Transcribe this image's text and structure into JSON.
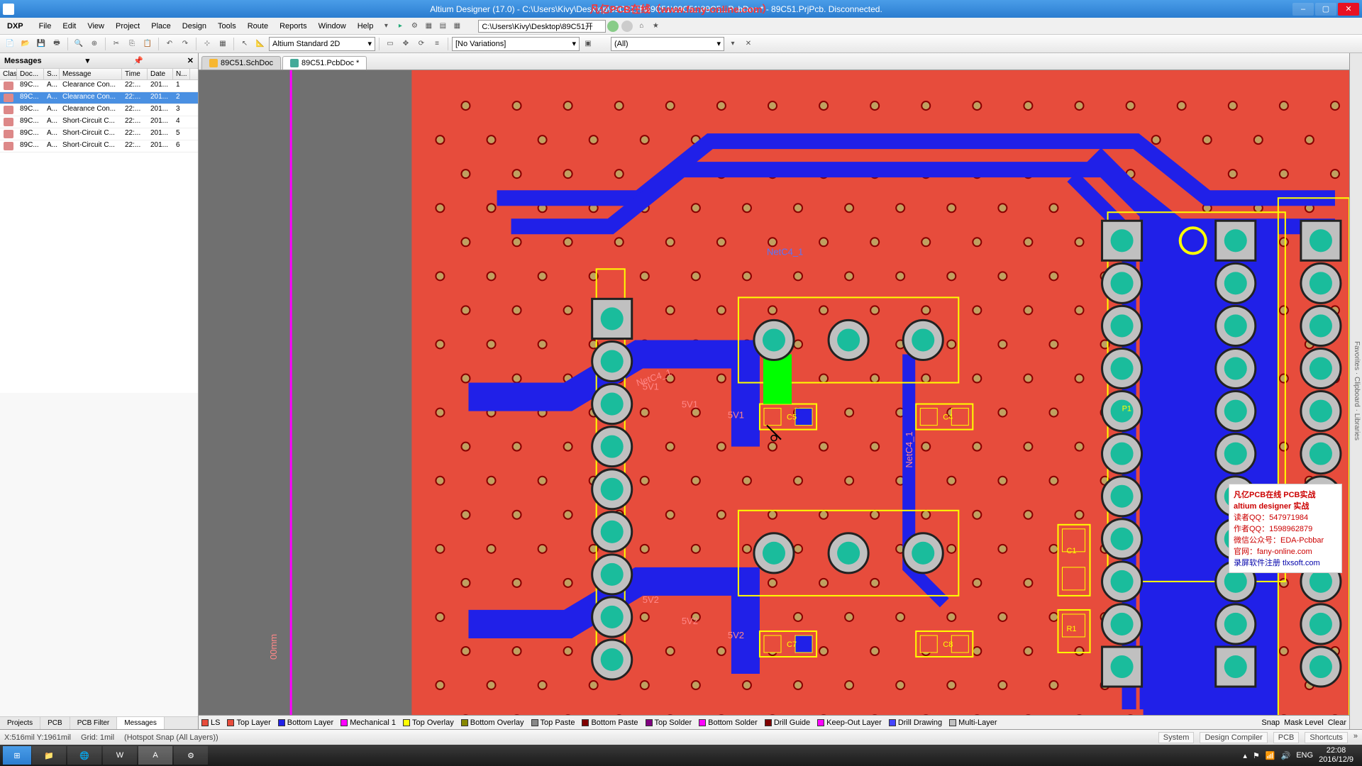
{
  "title": "Altium Designer (17.0) - C:\\Users\\Kivy\\Desktop\\89C51开\\89C51\\89C51\\89C51.PcbDoc * - 89C51.PrjPcb. Disconnected.",
  "overlay_text": "凡亿PCB在线（www.fany-online.com）",
  "menus": {
    "dxp": "DXP",
    "file": "File",
    "edit": "Edit",
    "view": "View",
    "project": "Project",
    "place": "Place",
    "design": "Design",
    "tools": "Tools",
    "route": "Route",
    "reports": "Reports",
    "window": "Window",
    "help": "Help"
  },
  "url_box": "C:\\Users\\Kivy\\Desktop\\89C51开",
  "view_mode": "Altium Standard 2D",
  "variations": "[No Variations]",
  "filter_all": "(All)",
  "messages_panel": {
    "title": "Messages",
    "columns": {
      "class": "Class",
      "doc": "Doc...",
      "s": "S...",
      "msg": "Message",
      "time": "Time",
      "date": "Date",
      "n": "N..."
    },
    "rows": [
      {
        "doc": "89C...",
        "s": "A...",
        "msg": "Clearance Con...",
        "time": "22:...",
        "date": "201...",
        "n": "1",
        "sel": false
      },
      {
        "doc": "89C...",
        "s": "A...",
        "msg": "Clearance Con...",
        "time": "22:...",
        "date": "201...",
        "n": "2",
        "sel": true
      },
      {
        "doc": "89C...",
        "s": "A...",
        "msg": "Clearance Con...",
        "time": "22:...",
        "date": "201...",
        "n": "3",
        "sel": false
      },
      {
        "doc": "89C...",
        "s": "A...",
        "msg": "Short-Circuit C...",
        "time": "22:...",
        "date": "201...",
        "n": "4",
        "sel": false
      },
      {
        "doc": "89C...",
        "s": "A...",
        "msg": "Short-Circuit C...",
        "time": "22:...",
        "date": "201...",
        "n": "5",
        "sel": false
      },
      {
        "doc": "89C...",
        "s": "A...",
        "msg": "Short-Circuit C...",
        "time": "22:...",
        "date": "201...",
        "n": "6",
        "sel": false
      }
    ]
  },
  "panel_tabs": {
    "projects": "Projects",
    "pcb": "PCB",
    "pcb_filter": "PCB Filter",
    "messages": "Messages"
  },
  "doc_tabs": {
    "sch": "89C51.SchDoc",
    "pcb": "89C51.PcbDoc *"
  },
  "layers": {
    "ls": "LS",
    "top": "Top Layer",
    "bottom": "Bottom Layer",
    "mech": "Mechanical 1",
    "top_overlay": "Top Overlay",
    "bot_overlay": "Bottom Overlay",
    "top_paste": "Top Paste",
    "bot_paste": "Bottom Paste",
    "top_solder": "Top Solder",
    "bot_solder": "Bottom Solder",
    "drill_guide": "Drill Guide",
    "keepout": "Keep-Out Layer",
    "drill_draw": "Drill Drawing",
    "multi": "Multi-Layer"
  },
  "layer_right": {
    "snap": "Snap",
    "mask": "Mask Level",
    "clear": "Clear"
  },
  "status": {
    "coord": "X:516mil Y:1961mil",
    "grid": "Grid: 1mil",
    "snap": "(Hotspot Snap (All Layers))"
  },
  "status_right": {
    "system": "System",
    "design_compiler": "Design Compiler",
    "pcb": "PCB",
    "shortcuts": "Shortcuts"
  },
  "nets": {
    "netc4": "NetC4_1",
    "v5_1": "5V1",
    "v5_2": "5V2"
  },
  "designators": {
    "p1": "P1",
    "c1": "C1",
    "r1": "R1",
    "c4": "C4",
    "c5": "C5",
    "c7": "C7",
    "c8": "C8"
  },
  "ruler": "00mm",
  "watermark": {
    "title1": "凡亿PCB在线 PCB实战",
    "title2": "altium designer 实战",
    "qq1": "读者QQ：547971984",
    "qq2": "作者QQ：1598962879",
    "wx": "微信公众号：EDA-Pcbbar",
    "site": "官网：fany-online.com",
    "extra": "录屏软件注册 tlxsoft.com"
  },
  "taskbar": {
    "time": "22:08",
    "date": "2016/12/9",
    "lang": "ENG"
  }
}
